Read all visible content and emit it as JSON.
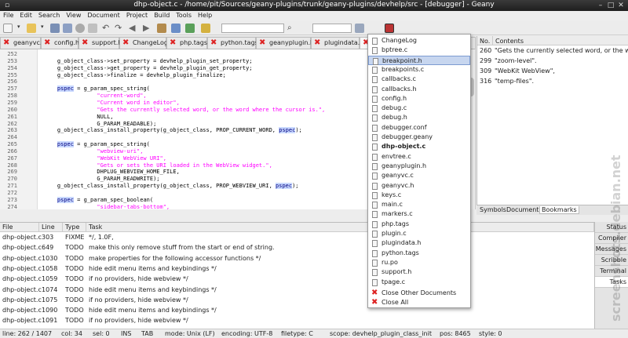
{
  "window": {
    "title": "dhp-object.c - /home/pit/Sources/geany-plugins/trunk/geany-plugins/devhelp/src - [debugger] - Geany"
  },
  "menu": [
    "File",
    "Edit",
    "Search",
    "View",
    "Document",
    "Project",
    "Build",
    "Tools",
    "Help"
  ],
  "tabs": [
    {
      "label": "geanyvc.h"
    },
    {
      "label": "config.h"
    },
    {
      "label": "support.h"
    },
    {
      "label": "ChangeLog"
    },
    {
      "label": "php.tags"
    },
    {
      "label": "python.tags"
    },
    {
      "label": "geanyplugin.h"
    },
    {
      "label": "plugindata.h"
    },
    {
      "label": "pl"
    }
  ],
  "editor": {
    "lines": [
      {
        "n": "252",
        "text": ""
      },
      {
        "n": "253",
        "text": "    g_object_class->set_property = devhelp_plugin_set_property;"
      },
      {
        "n": "254",
        "text": "    g_object_class->get_property = devhelp_plugin_get_property;"
      },
      {
        "n": "255",
        "text": "    g_object_class->finalize = devhelp_plugin_finalize;"
      },
      {
        "n": "256",
        "text": ""
      },
      {
        "n": "257",
        "text": "    pspec = g_param_spec_string("
      },
      {
        "n": "258",
        "text": "                \"current-word\","
      },
      {
        "n": "259",
        "text": "                \"Current word in editor\","
      },
      {
        "n": "260",
        "text": "                \"Gets the currently selected word, or the word where the cursor is.\","
      },
      {
        "n": "261",
        "text": "                NULL,"
      },
      {
        "n": "262",
        "text": "                G_PARAM_READABLE);"
      },
      {
        "n": "263",
        "text": "    g_object_class_install_property(g_object_class, PROP_CURRENT_WORD, pspec);"
      },
      {
        "n": "264",
        "text": ""
      },
      {
        "n": "265",
        "text": "    pspec = g_param_spec_string("
      },
      {
        "n": "266",
        "text": "                \"webview-uri\","
      },
      {
        "n": "267",
        "text": "                \"WebKit WebView URI\","
      },
      {
        "n": "268",
        "text": "                \"Gets or sets the URI loaded in the WebView widget.\","
      },
      {
        "n": "269",
        "text": "                DHPLUG_WEBVIEW_HOME_FILE,"
      },
      {
        "n": "270",
        "text": "                G_PARAM_READWRITE);"
      },
      {
        "n": "271",
        "text": "    g_object_class_install_property(g_object_class, PROP_WEBVIEW_URI, pspec);"
      },
      {
        "n": "272",
        "text": ""
      },
      {
        "n": "273",
        "text": "    pspec = g_param_spec_boolean("
      },
      {
        "n": "274",
        "text": "                \"sidebar-tabs-bottom\","
      }
    ]
  },
  "right_panel": {
    "headers": [
      "No.",
      "Contents"
    ],
    "rows": [
      {
        "no": "260",
        "contents": "\"Gets the currently selected word, or the wo"
      },
      {
        "no": "299",
        "contents": "\"zoom-level\"."
      },
      {
        "no": "309",
        "contents": "\"WebKit WebView\","
      },
      {
        "no": "316",
        "contents": "\"temp-files\"."
      }
    ],
    "tabs": [
      "Symbols",
      "Documents",
      "Bookmarks"
    ]
  },
  "popup": {
    "items": [
      "ChangeLog",
      "bptree.c",
      "breakpoint.h",
      "breakpoints.c",
      "callbacks.c",
      "callbacks.h",
      "config.h",
      "debug.c",
      "debug.h",
      "debugger.conf",
      "debugger.geany",
      "dhp-object.c",
      "envtree.c",
      "geanyplugin.h",
      "geanyvc.c",
      "geanyvc.h",
      "keys.c",
      "main.c",
      "markers.c",
      "php.tags",
      "plugin.c",
      "plugindata.h",
      "python.tags",
      "ru.po",
      "support.h",
      "tpage.c"
    ],
    "close_other": "Close Other Documents",
    "close_all": "Close All"
  },
  "tasks": {
    "headers": [
      "File",
      "Line",
      "Type",
      "Task"
    ],
    "rows": [
      {
        "file": "dhp-object.c",
        "line": "303",
        "type": "FIXME",
        "task": "*/, 1.0F,"
      },
      {
        "file": "dhp-object.c",
        "line": "649",
        "type": "TODO",
        "task": "make this only remove stuff from the start or end of string."
      },
      {
        "file": "dhp-object.c",
        "line": "1030",
        "type": "TODO",
        "task": "make properties for the following accessor functions */"
      },
      {
        "file": "dhp-object.c",
        "line": "1058",
        "type": "TODO",
        "task": "hide edit menu items and keybindings */"
      },
      {
        "file": "dhp-object.c",
        "line": "1059",
        "type": "TODO",
        "task": "if no providers, hide webview */"
      },
      {
        "file": "dhp-object.c",
        "line": "1074",
        "type": "TODO",
        "task": "hide edit menu items and keybindings */"
      },
      {
        "file": "dhp-object.c",
        "line": "1075",
        "type": "TODO",
        "task": "if no providers, hide webview */"
      },
      {
        "file": "dhp-object.c",
        "line": "1090",
        "type": "TODO",
        "task": "hide edit menu items and keybindings */"
      },
      {
        "file": "dhp-object.c",
        "line": "1091",
        "type": "TODO",
        "task": "if no providers, hide webview */"
      }
    ]
  },
  "bottom_tabs": [
    "Status",
    "Compiler",
    "Messages",
    "Scribble",
    "Terminal",
    "Tasks"
  ],
  "status": {
    "line": "line: 262 / 1407",
    "col": "col: 34",
    "sel": "sel: 0",
    "ins": "INS",
    "tab": "TAB",
    "mode": "mode: Unix (LF)",
    "encoding": "encoding: UTF-8",
    "filetype": "filetype: C",
    "scope": "scope: devhelp_plugin_class_init",
    "pos": "pos: 8465",
    "style": "style: 0"
  },
  "watermark": "screenshots.debian.net",
  "colors": {
    "string": "#ff00ff",
    "keyword_bg": "#c8d8ff",
    "close_x": "#dd2222",
    "highlight": "#c7d6ef"
  }
}
